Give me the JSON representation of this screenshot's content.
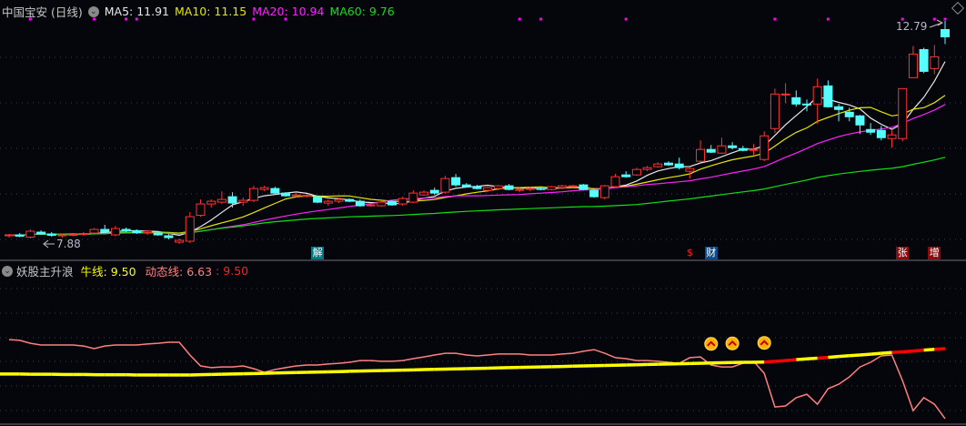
{
  "header": {
    "stock_name": "中国宝安 (日线)",
    "ma5": {
      "label": "MA5: 11.91",
      "color": "#e8e8e8"
    },
    "ma10": {
      "label": "MA10: 11.15",
      "color": "#e6e600"
    },
    "ma20": {
      "label": "MA20: 10.94",
      "color": "#ff22ff"
    },
    "ma60": {
      "label": "MA60: 9.76",
      "color": "#10e010"
    }
  },
  "price_labels": {
    "high": "12.79",
    "low": "7.88"
  },
  "events": [
    {
      "text": "解",
      "index": 29,
      "bg": "#007a80",
      "color": "#ffffff"
    },
    {
      "text": "$",
      "index": 64,
      "bg": "transparent",
      "color": "#ff2020"
    },
    {
      "text": "财",
      "index": 66,
      "bg": "#0b4d8c",
      "color": "#ffffff"
    },
    {
      "text": "张",
      "index": 84,
      "bg": "#8a0c0c",
      "color": "#ffffff"
    },
    {
      "text": "增",
      "index": 87,
      "bg": "#8a0c0c",
      "color": "#ffffff"
    }
  ],
  "indicator": {
    "name": "妖股主升浪",
    "bull_label": "牛线: 9.50",
    "dyn_label": "动态线: 6.63",
    "dyn_sep": ":",
    "dyn_extra": "9.50",
    "colors": {
      "bull": "#ffff00",
      "bull_alt": "#ff0000",
      "dyn": "#ff8080",
      "name": "#c8c8c8",
      "extra": "#ff2020"
    }
  },
  "chart_data": {
    "type": "candlestick",
    "title": "中国宝安 (日线)",
    "ylim": [
      7.88,
      12.79
    ],
    "candles_ohlc": [
      [
        8.06,
        8.1,
        8.02,
        8.08
      ],
      [
        8.08,
        8.12,
        8.03,
        8.05
      ],
      [
        8.03,
        8.2,
        8.0,
        8.16
      ],
      [
        8.14,
        8.18,
        8.08,
        8.1
      ],
      [
        8.1,
        8.14,
        8.04,
        8.07
      ],
      [
        8.06,
        8.1,
        8.02,
        8.08
      ],
      [
        8.08,
        8.12,
        8.05,
        8.09
      ],
      [
        8.09,
        8.14,
        8.06,
        8.11
      ],
      [
        8.12,
        8.23,
        8.08,
        8.2
      ],
      [
        8.2,
        8.3,
        8.12,
        8.14
      ],
      [
        8.08,
        8.28,
        8.05,
        8.22
      ],
      [
        8.2,
        8.24,
        8.14,
        8.17
      ],
      [
        8.17,
        8.2,
        8.1,
        8.13
      ],
      [
        8.13,
        8.18,
        8.08,
        8.16
      ],
      [
        8.12,
        8.16,
        8.06,
        8.08
      ],
      [
        8.06,
        8.1,
        7.98,
        8.02
      ],
      [
        7.92,
        8.0,
        7.88,
        7.96
      ],
      [
        7.94,
        8.58,
        7.9,
        8.48
      ],
      [
        8.51,
        8.86,
        8.48,
        8.76
      ],
      [
        8.76,
        8.86,
        8.68,
        8.82
      ],
      [
        8.8,
        9.04,
        8.76,
        8.86
      ],
      [
        8.92,
        9.02,
        8.68,
        8.78
      ],
      [
        8.8,
        8.9,
        8.72,
        8.84
      ],
      [
        8.84,
        9.16,
        8.8,
        9.1
      ],
      [
        9.08,
        9.16,
        9.04,
        9.12
      ],
      [
        9.1,
        9.14,
        8.98,
        9.0
      ],
      [
        9.0,
        9.02,
        8.92,
        8.94
      ],
      [
        8.96,
        9.0,
        8.9,
        8.96
      ],
      [
        8.94,
        8.98,
        8.9,
        8.95
      ],
      [
        8.92,
        8.94,
        8.78,
        8.8
      ],
      [
        8.78,
        8.86,
        8.72,
        8.82
      ],
      [
        8.82,
        8.9,
        8.78,
        8.86
      ],
      [
        8.86,
        8.88,
        8.8,
        8.82
      ],
      [
        8.82,
        8.86,
        8.7,
        8.72
      ],
      [
        8.74,
        8.78,
        8.7,
        8.74
      ],
      [
        8.72,
        8.84,
        8.7,
        8.8
      ],
      [
        8.82,
        8.84,
        8.72,
        8.74
      ],
      [
        8.76,
        8.92,
        8.72,
        8.88
      ],
      [
        8.8,
        9.06,
        8.78,
        9.0
      ],
      [
        8.96,
        9.06,
        8.94,
        9.02
      ],
      [
        9.06,
        9.12,
        8.96,
        9.0
      ],
      [
        9.02,
        9.38,
        8.98,
        9.32
      ],
      [
        9.34,
        9.42,
        9.14,
        9.18
      ],
      [
        9.18,
        9.22,
        9.12,
        9.14
      ],
      [
        9.14,
        9.18,
        9.08,
        9.1
      ],
      [
        9.06,
        9.14,
        9.02,
        9.12
      ],
      [
        9.1,
        9.18,
        9.06,
        9.16
      ],
      [
        9.16,
        9.2,
        9.06,
        9.08
      ],
      [
        9.08,
        9.12,
        9.02,
        9.08
      ],
      [
        9.1,
        9.14,
        9.04,
        9.1
      ],
      [
        9.1,
        9.12,
        9.06,
        9.09
      ],
      [
        9.08,
        9.16,
        9.06,
        9.14
      ],
      [
        9.12,
        9.18,
        9.08,
        9.16
      ],
      [
        9.14,
        9.18,
        9.12,
        9.16
      ],
      [
        9.18,
        9.2,
        9.06,
        9.08
      ],
      [
        9.06,
        9.08,
        8.9,
        8.92
      ],
      [
        8.9,
        9.18,
        8.86,
        9.16
      ],
      [
        9.14,
        9.42,
        9.12,
        9.36
      ],
      [
        9.4,
        9.48,
        9.34,
        9.36
      ],
      [
        9.4,
        9.56,
        9.38,
        9.52
      ],
      [
        9.52,
        9.6,
        9.48,
        9.56
      ],
      [
        9.58,
        9.68,
        9.56,
        9.64
      ],
      [
        9.66,
        9.7,
        9.6,
        9.62
      ],
      [
        9.64,
        9.78,
        9.52,
        9.56
      ],
      [
        9.48,
        9.56,
        9.32,
        9.54
      ],
      [
        9.7,
        10.16,
        9.68,
        9.96
      ],
      [
        9.96,
        10.06,
        9.88,
        9.9
      ],
      [
        9.88,
        10.22,
        9.86,
        10.04
      ],
      [
        10.04,
        10.12,
        9.96,
        10.0
      ],
      [
        9.98,
        10.04,
        9.92,
        9.94
      ],
      [
        9.94,
        10.08,
        9.84,
        9.96
      ],
      [
        9.74,
        10.36,
        9.7,
        10.26
      ],
      [
        10.42,
        11.3,
        10.32,
        11.18
      ],
      [
        11.16,
        11.42,
        10.98,
        11.18
      ],
      [
        11.1,
        11.26,
        10.9,
        10.96
      ],
      [
        10.96,
        11.06,
        10.8,
        10.94
      ],
      [
        10.96,
        11.52,
        10.52,
        11.34
      ],
      [
        11.36,
        11.48,
        10.88,
        10.9
      ],
      [
        10.9,
        10.96,
        10.58,
        10.84
      ],
      [
        10.78,
        10.88,
        10.58,
        10.68
      ],
      [
        10.7,
        10.72,
        10.3,
        10.5
      ],
      [
        10.4,
        10.54,
        10.28,
        10.34
      ],
      [
        10.38,
        10.48,
        10.16,
        10.22
      ],
      [
        10.2,
        10.38,
        10.0,
        10.28
      ],
      [
        10.2,
        11.3,
        10.14,
        11.3
      ],
      [
        11.54,
        12.24,
        11.54,
        12.06
      ],
      [
        12.16,
        12.2,
        11.64,
        11.68
      ],
      [
        11.74,
        12.26,
        11.62,
        12.0
      ],
      [
        12.6,
        12.79,
        12.28,
        12.44
      ]
    ],
    "ma_periods": [
      5,
      10,
      20,
      60
    ],
    "signal_dot_indices": [
      2,
      8,
      11,
      12,
      23,
      26,
      48,
      50,
      58,
      72,
      77,
      84,
      87,
      88
    ],
    "indicator_series": {
      "dyn_line": [
        9.87,
        9.84,
        9.72,
        9.65,
        9.65,
        9.65,
        9.65,
        9.61,
        9.5,
        9.61,
        9.65,
        9.65,
        9.65,
        9.69,
        9.72,
        9.76,
        9.76,
        9.24,
        8.79,
        8.72,
        8.75,
        8.75,
        8.79,
        8.68,
        8.53,
        8.64,
        8.72,
        8.79,
        8.83,
        8.83,
        8.87,
        8.9,
        8.94,
        9.01,
        9.01,
        8.98,
        8.98,
        9.01,
        9.09,
        9.16,
        9.24,
        9.31,
        9.31,
        9.24,
        9.2,
        9.24,
        9.28,
        9.28,
        9.28,
        9.24,
        9.24,
        9.24,
        9.28,
        9.31,
        9.39,
        9.46,
        9.31,
        9.13,
        9.09,
        9.01,
        9.01,
        8.98,
        8.94,
        8.9,
        9.13,
        9.16,
        8.83,
        8.75,
        8.75,
        8.9,
        8.98,
        8.49,
        7.11,
        7.15,
        7.49,
        7.63,
        7.22,
        7.86,
        8.04,
        8.34,
        8.75,
        8.94,
        9.2,
        9.24,
        8.19,
        6.96,
        7.49,
        7.22,
        6.63
      ],
      "bull_line": [
        8.46,
        8.46,
        8.45,
        8.45,
        8.45,
        8.44,
        8.44,
        8.44,
        8.43,
        8.43,
        8.43,
        8.43,
        8.42,
        8.42,
        8.42,
        8.42,
        8.42,
        8.42,
        8.43,
        8.44,
        8.45,
        8.46,
        8.47,
        8.48,
        8.49,
        8.5,
        8.51,
        8.52,
        8.53,
        8.54,
        8.55,
        8.56,
        8.57,
        8.58,
        8.59,
        8.6,
        8.61,
        8.62,
        8.63,
        8.64,
        8.65,
        8.66,
        8.67,
        8.68,
        8.69,
        8.7,
        8.71,
        8.72,
        8.73,
        8.74,
        8.75,
        8.76,
        8.77,
        8.78,
        8.79,
        8.8,
        8.81,
        8.82,
        8.83,
        8.84,
        8.85,
        8.86,
        8.87,
        8.88,
        8.89,
        8.9,
        8.91,
        8.92,
        8.93,
        8.94,
        8.94,
        8.95,
        8.98,
        9.01,
        9.05,
        9.08,
        9.11,
        9.14,
        9.18,
        9.21,
        9.24,
        9.27,
        9.31,
        9.34,
        9.37,
        9.4,
        9.44,
        9.47,
        9.5
      ],
      "bull_red_ranges": [
        [
          71,
          74
        ],
        [
          76,
          77
        ],
        [
          83,
          86
        ],
        [
          87,
          88
        ]
      ],
      "buy_signal_indices": [
        66,
        68,
        71
      ]
    }
  }
}
